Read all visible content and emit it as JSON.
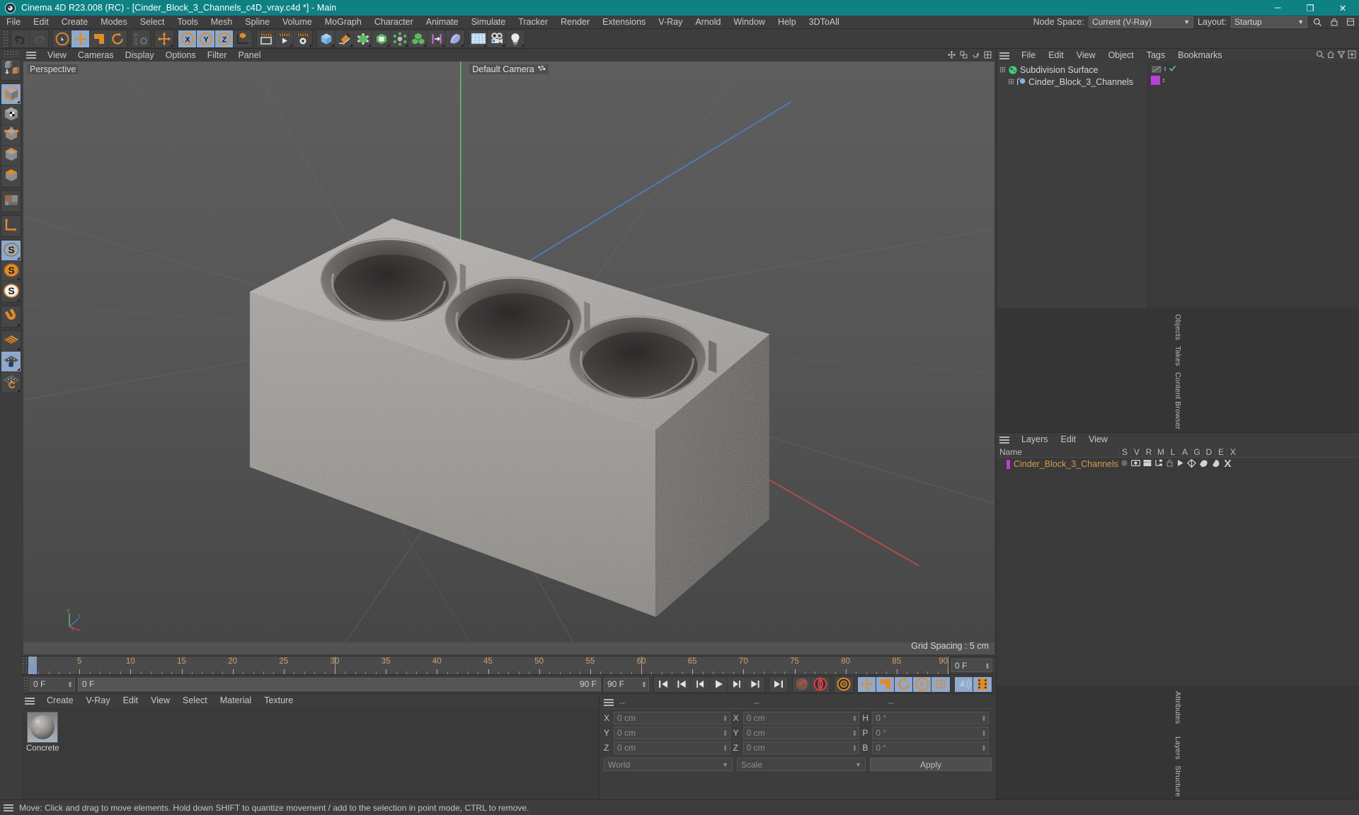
{
  "window": {
    "title": "Cinema 4D R23.008 (RC) - [Cinder_Block_3_Channels_c4D_vray.c4d *] - Main",
    "logo_icon": "cinema4d-logo-icon",
    "minimize_label": "─",
    "maximize_label": "❐",
    "close_label": "✕",
    "titlebar_color": "#0e8184"
  },
  "menubar": {
    "items": [
      "File",
      "Edit",
      "Create",
      "Modes",
      "Select",
      "Tools",
      "Mesh",
      "Spline",
      "Volume",
      "MoGraph",
      "Character",
      "Animate",
      "Simulate",
      "Tracker",
      "Render",
      "Extensions",
      "V-Ray",
      "Arnold",
      "Window",
      "Help",
      "3DToAll"
    ],
    "node_space_label": "Node Space:",
    "node_space_value": "Current (V-Ray)",
    "layout_label": "Layout:",
    "layout_value": "Startup",
    "search_icon": "search-icon"
  },
  "toolbar": {
    "groups": [
      {
        "name": "undo-redo",
        "buttons": [
          {
            "name": "undo-button",
            "icon": "undo-icon",
            "active": false,
            "arrow": false
          },
          {
            "name": "redo-button",
            "icon": "redo-icon",
            "active": false,
            "arrow": false
          }
        ]
      },
      {
        "name": "tools",
        "buttons": [
          {
            "name": "live-selection-tool",
            "icon": "cursor-circle-icon",
            "active": false,
            "arrow": true
          },
          {
            "name": "move-tool",
            "icon": "move-arrows-icon",
            "active": true,
            "arrow": false
          },
          {
            "name": "scale-tool",
            "icon": "scale-box-icon",
            "active": false,
            "arrow": false
          },
          {
            "name": "rotate-tool",
            "icon": "rotate-icon",
            "active": false,
            "arrow": false
          }
        ]
      },
      {
        "name": "psr",
        "buttons": [
          {
            "name": "psr-toggle",
            "icon": "psr-icon",
            "active": false,
            "arrow": false
          }
        ]
      },
      {
        "name": "move-dup",
        "buttons": [
          {
            "name": "move-tool-secondary",
            "icon": "move-arrows-icon",
            "active": false,
            "arrow": true
          }
        ]
      },
      {
        "name": "axis-locks",
        "buttons": [
          {
            "name": "x-axis-lock",
            "icon": "x-axis-icon",
            "active": true,
            "arrow": false
          },
          {
            "name": "y-axis-lock",
            "icon": "y-axis-icon",
            "active": true,
            "arrow": false
          },
          {
            "name": "z-axis-lock",
            "icon": "z-axis-icon",
            "active": true,
            "arrow": false
          },
          {
            "name": "world-object-axis",
            "icon": "world-axis-cube-icon",
            "active": false,
            "arrow": false
          }
        ]
      },
      {
        "name": "render",
        "buttons": [
          {
            "name": "render-view-button",
            "icon": "render-view-icon",
            "active": false,
            "arrow": false
          },
          {
            "name": "render-to-picture-viewer-button",
            "icon": "render-picture-icon",
            "active": false,
            "arrow": true
          },
          {
            "name": "render-settings-button",
            "icon": "render-settings-icon",
            "active": false,
            "arrow": true
          }
        ]
      },
      {
        "name": "objects",
        "buttons": [
          {
            "name": "add-cube-button",
            "icon": "cube-icon",
            "active": false,
            "arrow": true
          },
          {
            "name": "add-spline-button",
            "icon": "pen-spline-icon",
            "active": false,
            "arrow": true
          },
          {
            "name": "generators-button",
            "icon": "generator-cage-icon",
            "active": false,
            "arrow": true
          },
          {
            "name": "bend-deformer-button",
            "icon": "nurbs-icon",
            "active": false,
            "arrow": true
          },
          {
            "name": "environment-button",
            "icon": "atom-icon",
            "active": false,
            "arrow": true
          },
          {
            "name": "mograph-button",
            "icon": "cloner-cubes-icon",
            "active": false,
            "arrow": true
          },
          {
            "name": "deformer-button",
            "icon": "deformer-icon",
            "active": false,
            "arrow": true
          },
          {
            "name": "field-button",
            "icon": "field-icon",
            "active": false,
            "arrow": true
          }
        ]
      },
      {
        "name": "scene",
        "buttons": [
          {
            "name": "floor-button",
            "icon": "floor-grid-icon",
            "active": false,
            "arrow": true
          },
          {
            "name": "camera-button",
            "icon": "camera-icon",
            "active": false,
            "arrow": true
          },
          {
            "name": "light-button",
            "icon": "light-bulb-icon",
            "active": false,
            "arrow": true
          }
        ]
      }
    ]
  },
  "left_toolbar": {
    "groups": [
      {
        "name": "mode-convert",
        "buttons": [
          {
            "name": "make-editable-button",
            "icon": "make-editable-icon",
            "active": false
          }
        ]
      },
      {
        "name": "object-modes",
        "buttons": [
          {
            "name": "model-mode-button",
            "icon": "model-cube-icon",
            "active": true,
            "arrow": true
          },
          {
            "name": "texture-mode-button",
            "icon": "texture-checker-cube-icon",
            "active": false
          },
          {
            "name": "points-mode-button",
            "icon": "points-cube-icon",
            "active": false
          },
          {
            "name": "edges-mode-button",
            "icon": "edges-cube-icon",
            "active": false
          },
          {
            "name": "polygons-mode-button",
            "icon": "polygons-cube-icon",
            "active": false
          }
        ]
      },
      {
        "name": "uv",
        "buttons": [
          {
            "name": "uv-mode-button",
            "icon": "uv-tiles-icon",
            "active": false
          }
        ]
      },
      {
        "name": "axis",
        "buttons": [
          {
            "name": "enable-axis-modification-button",
            "icon": "axis-L-icon",
            "active": false
          }
        ]
      },
      {
        "name": "s-modes",
        "buttons": [
          {
            "name": "viewport-solo-off-button",
            "icon": "s-grey-icon",
            "active": true,
            "arrow": true
          },
          {
            "name": "viewport-solo-single-button",
            "icon": "s-orange-icon",
            "active": false,
            "arrow": true
          },
          {
            "name": "viewport-solo-hierarchy-button",
            "icon": "s-white-icon",
            "active": false,
            "arrow": true
          }
        ]
      },
      {
        "name": "snap",
        "buttons": [
          {
            "name": "enable-snapping-button",
            "icon": "magnet-icon",
            "active": false,
            "arrow": true
          }
        ]
      },
      {
        "name": "workplane",
        "buttons": [
          {
            "name": "workplane-button",
            "icon": "workplane-grid-icon",
            "active": false,
            "arrow": true
          },
          {
            "name": "lock-workplane-button",
            "icon": "workplane-lock-icon",
            "active": true,
            "arrow": true
          },
          {
            "name": "planar-workplane-button",
            "icon": "workplane-rotate-icon",
            "active": false,
            "arrow": true
          }
        ]
      }
    ]
  },
  "viewport": {
    "menu": [
      "View",
      "Cameras",
      "Display",
      "Options",
      "Filter",
      "Panel"
    ],
    "projection_label": "Perspective",
    "camera_label": "Default Camera",
    "camera_icon": "camera-dots-icon",
    "grid_spacing_label": "Grid Spacing : 5 cm",
    "axis_labels": {
      "x": "X",
      "y": "Y",
      "z": "Z"
    },
    "header_icons": [
      "viewport-move-icon",
      "viewport-scale-icon",
      "viewport-rotate-icon",
      "viewport-maximize-icon"
    ],
    "background_top": "#5c5c5c",
    "background_bottom": "#4a4a4a",
    "axis_x_color": "#c4504d",
    "axis_y_color": "#62b562",
    "axis_z_color": "#4a72b8"
  },
  "timeline": {
    "ruler_min": 0,
    "ruler_max": 90,
    "ticks": [
      0,
      5,
      10,
      15,
      20,
      25,
      30,
      35,
      40,
      45,
      50,
      55,
      60,
      65,
      70,
      75,
      80,
      85,
      90
    ],
    "playhead_frame": 0,
    "right_field": "0 F"
  },
  "transport": {
    "current_frame_field": "0 F",
    "range_start_field": "0 F",
    "range_end_label": "90 F",
    "end_frame_field": "90 F",
    "preview_end_field": "90 F",
    "buttons": [
      {
        "name": "go-to-start-button",
        "icon": "skip-start-icon"
      },
      {
        "name": "go-to-previous-key-button",
        "icon": "prev-key-icon"
      },
      {
        "name": "go-to-previous-frame-button",
        "icon": "step-back-icon"
      },
      {
        "name": "play-button",
        "icon": "play-icon"
      },
      {
        "name": "go-to-next-frame-button",
        "icon": "step-forward-icon"
      },
      {
        "name": "go-to-next-key-button",
        "icon": "next-key-icon"
      },
      {
        "name": "go-to-end-button",
        "icon": "skip-end-icon"
      },
      {
        "name": "record-active-objects-button",
        "icon": "record-key-icon"
      },
      {
        "name": "autokeying-button",
        "icon": "autokey-icon"
      },
      {
        "name": "keyframe-selection-button",
        "icon": "keyframe-select-icon"
      },
      {
        "name": "position-key-button",
        "icon": "position-key-icon"
      },
      {
        "name": "scale-key-button",
        "icon": "scale-key-icon"
      },
      {
        "name": "rotation-key-button",
        "icon": "rotation-key-icon"
      },
      {
        "name": "pla-key-button",
        "icon": "pla-key-icon"
      },
      {
        "name": "point-level-animation-button",
        "icon": "dots-grid-icon"
      },
      {
        "name": "play-sound-button",
        "icon": "sound-icon"
      },
      {
        "name": "timeline-filmstrip-button",
        "icon": "filmstrip-icon"
      }
    ]
  },
  "material_manager": {
    "menu": [
      "Create",
      "V-Ray",
      "Edit",
      "View",
      "Select",
      "Material",
      "Texture"
    ],
    "materials": [
      {
        "name": "Concrete",
        "icon": "material-sphere-icon"
      }
    ]
  },
  "coordinates": {
    "header_dashes": [
      "--",
      "--",
      "--"
    ],
    "rows": [
      {
        "label1": "X",
        "value1": "0 cm",
        "label2": "X",
        "value2": "0 cm",
        "label3": "H",
        "value3": "0 °"
      },
      {
        "label1": "Y",
        "value1": "0 cm",
        "label2": "Y",
        "value2": "0 cm",
        "label3": "P",
        "value3": "0 °"
      },
      {
        "label1": "Z",
        "value1": "0 cm",
        "label2": "Z",
        "value2": "0 cm",
        "label3": "B",
        "value3": "0 °"
      }
    ],
    "space_value": "World",
    "mode_value": "Scale",
    "apply_label": "Apply"
  },
  "object_manager": {
    "menu": [
      "File",
      "Edit",
      "View",
      "Object",
      "Tags",
      "Bookmarks"
    ],
    "right_icons": [
      "search-icon",
      "home-icon",
      "filter-icon",
      "plus-icon"
    ],
    "rows": [
      {
        "name": "Subdivision Surface",
        "icon": "subdivision-surface-icon",
        "indent": 0,
        "tag_swatch": "",
        "tag_icon": "hidden-tag-icon",
        "check": true
      },
      {
        "name": "Cinder_Block_3_Channels",
        "icon": "polygon-object-icon",
        "indent": 1,
        "tag_swatch": "#b93fd8",
        "tag_icon": "",
        "check": false
      }
    ]
  },
  "layer_manager": {
    "menu": [
      "Layers",
      "Edit",
      "View"
    ],
    "columns": [
      "Name",
      "S",
      "V",
      "R",
      "M",
      "L",
      "A",
      "G",
      "D",
      "E",
      "X"
    ],
    "rows": [
      {
        "name": "Cinder_Block_3_Channels",
        "color": "#b93fd8"
      }
    ]
  },
  "right_tabs_top": [
    "Objects",
    "Takes",
    "Content Browser"
  ],
  "right_tabs_bottom": [
    "Attributes",
    "Layers",
    "Structure"
  ],
  "statusbar": {
    "text": "Move: Click and drag to move elements. Hold down SHIFT to quantize movement / add to the selection in point mode, CTRL to remove."
  }
}
